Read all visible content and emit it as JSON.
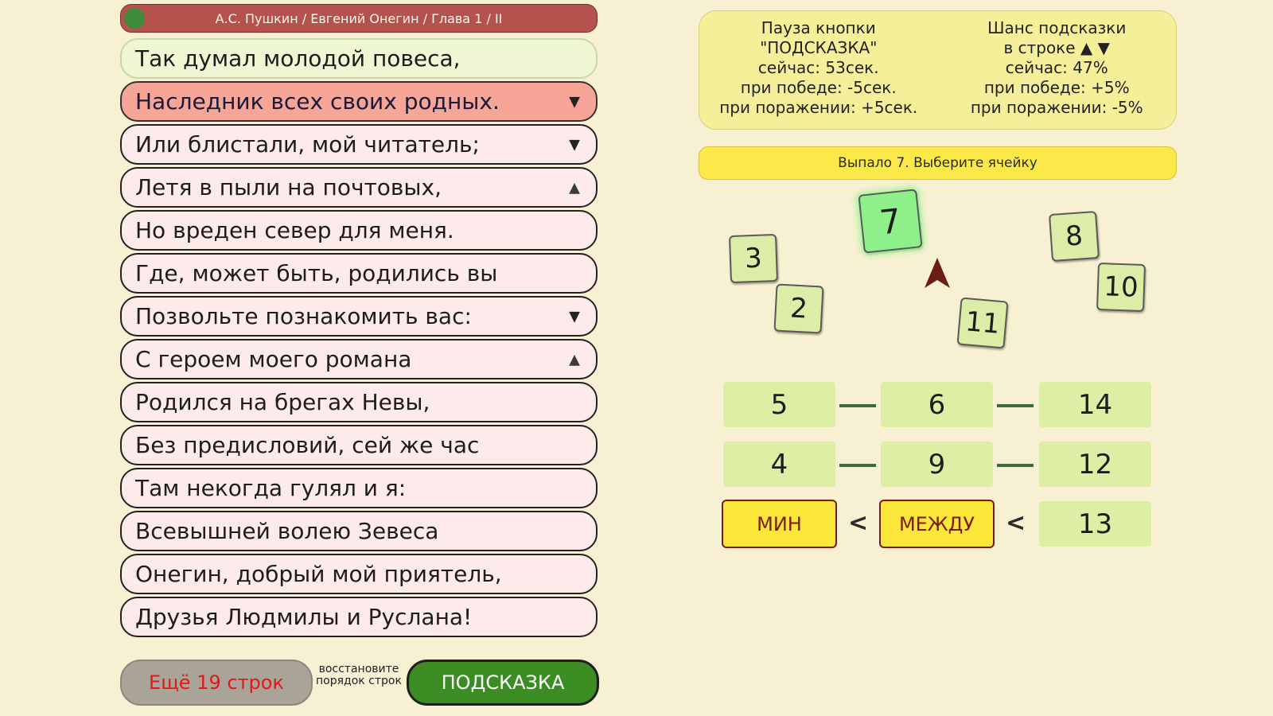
{
  "header": {
    "title": "А.С. Пушкин / Евгений Онегин / Глава 1 / II"
  },
  "lines": [
    {
      "text": "Так думал молодой повеса,",
      "arrow": ""
    },
    {
      "text": "Наследник всех своих родных.",
      "arrow": "▼"
    },
    {
      "text": "Или блистали, мой читатель;",
      "arrow": "▼"
    },
    {
      "text": "Летя в пыли на почтовых,",
      "arrow": "▲"
    },
    {
      "text": "Но вреден север для меня.",
      "arrow": ""
    },
    {
      "text": "Где, может быть, родились вы",
      "arrow": ""
    },
    {
      "text": "Позвольте познакомить вас:",
      "arrow": "▼"
    },
    {
      "text": "С героем моего романа",
      "arrow": "▲"
    },
    {
      "text": "Родился на брегах Невы,",
      "arrow": ""
    },
    {
      "text": "Без предисловий, сей же час",
      "arrow": ""
    },
    {
      "text": "Там некогда гулял и я:",
      "arrow": ""
    },
    {
      "text": "Всевышней волею Зевеса",
      "arrow": ""
    },
    {
      "text": "Онегин, добрый мой приятель,",
      "arrow": ""
    },
    {
      "text": "Друзья Людмилы и Руслана!",
      "arrow": ""
    }
  ],
  "bottom": {
    "more_label": "Ещё 19 строк",
    "restore_note": "восстановите порядок строк",
    "hint_label": "ПОДСКАЗКА"
  },
  "info": {
    "left": [
      "Пауза кнопки",
      "\"ПОДСКАЗКА\"",
      "сейчас: 53сек.",
      "при победе: -5сек.",
      "при поражении: +5сек."
    ],
    "right": [
      "Шанс подсказки",
      "в строке ▲ ▼",
      "сейчас: 47%",
      "при победе: +5%",
      "при поражении: -5%"
    ]
  },
  "status": "Выпало 7. Выберите ячейку",
  "tiles": {
    "current": "7",
    "t3": "3",
    "t2": "2",
    "t8": "8",
    "t10": "10",
    "t11": "11"
  },
  "grid": {
    "row1": [
      "5",
      "6",
      "14"
    ],
    "row2": [
      "4",
      "9",
      "12"
    ],
    "min_label": "МИН",
    "between_label": "МЕЖДУ",
    "last": "13",
    "lt_symbol": "<"
  },
  "colors": {
    "background": "#f8f0d2",
    "active_line": "#f7a597",
    "hint_button": "#3b8c22",
    "tile_current": "#8ef08a"
  }
}
